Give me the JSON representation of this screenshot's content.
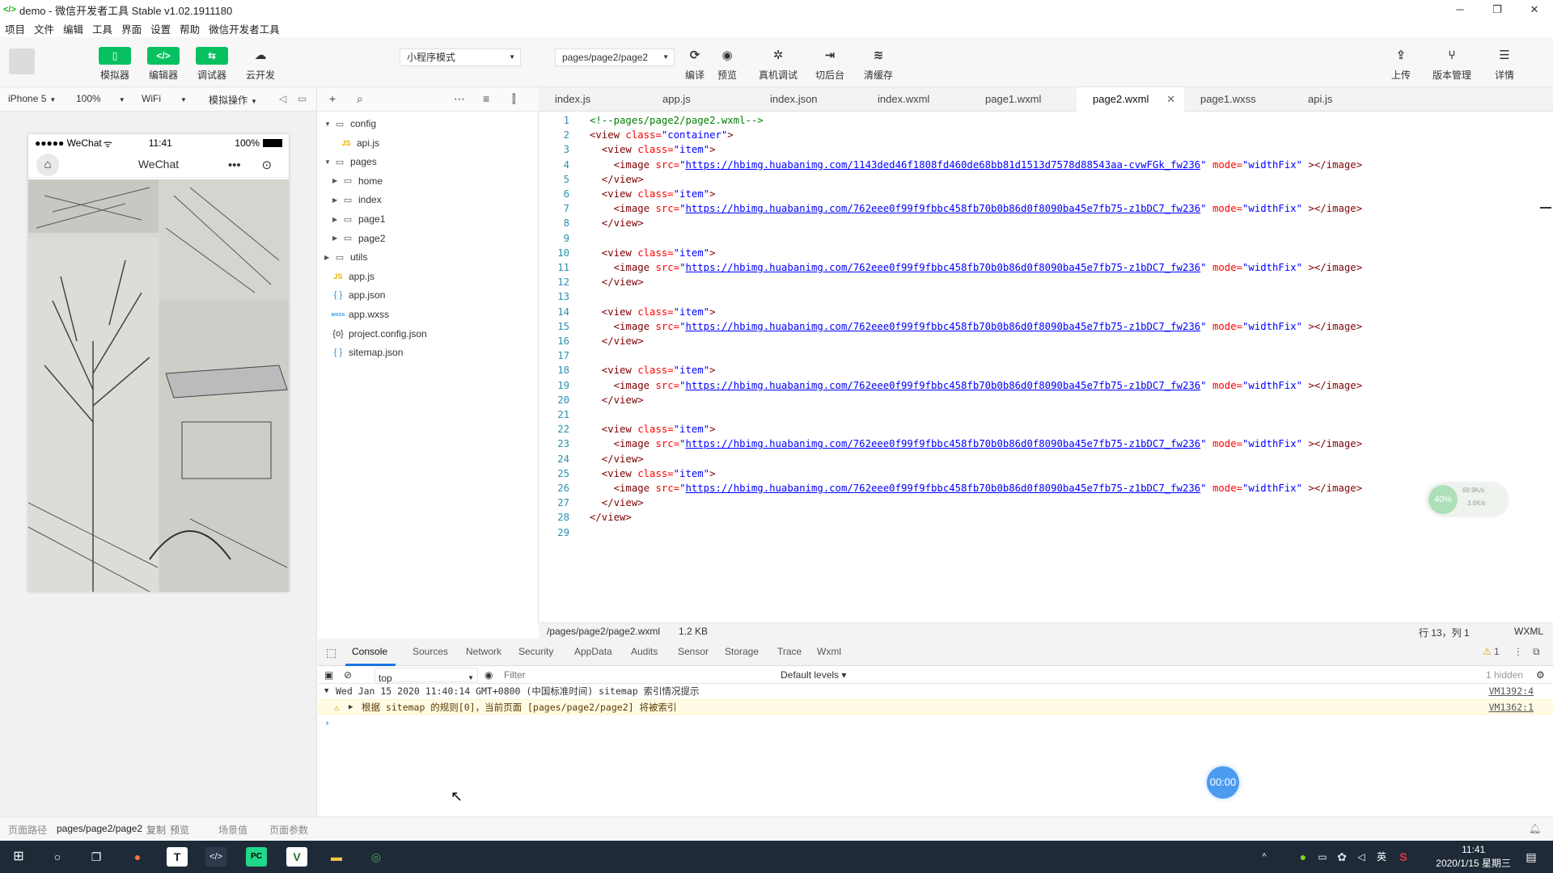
{
  "window": {
    "title": "demo - 微信开发者工具 Stable v1.02.1911180",
    "controls": [
      "─",
      "❐",
      "✕"
    ]
  },
  "menu": [
    "项目",
    "文件",
    "编辑",
    "工具",
    "界面",
    "设置",
    "帮助",
    "微信开发者工具"
  ],
  "toolbar": {
    "simulator": "模拟器",
    "editor": "编辑器",
    "debugger": "调试器",
    "cloud": "云开发",
    "mode_select": "小程序模式",
    "page_select": "pages/page2/page2",
    "compile": "编译",
    "preview": "预览",
    "remote_debug": "真机调试",
    "background": "切后台",
    "clear_cache": "清缓存",
    "upload": "上传",
    "version": "版本管理",
    "details": "详情"
  },
  "device_bar": {
    "device": "iPhone 5",
    "zoom": "100%",
    "network": "WiFi",
    "operations": "模拟操作"
  },
  "phone": {
    "signal": "●●●●● WeChat",
    "wifi": "ᯤ",
    "time": "11:41",
    "battery": "100%",
    "nav_title": "WeChat",
    "capsule_dots": "•••"
  },
  "explorer": [
    {
      "label": "config",
      "type": "folder",
      "depth": 0,
      "expanded": true
    },
    {
      "label": "api.js",
      "type": "js",
      "depth": 1
    },
    {
      "label": "pages",
      "type": "folder",
      "depth": 0,
      "expanded": true
    },
    {
      "label": "home",
      "type": "folder",
      "depth": 1,
      "expanded": false
    },
    {
      "label": "index",
      "type": "folder",
      "depth": 1,
      "expanded": false
    },
    {
      "label": "page1",
      "type": "folder",
      "depth": 1,
      "expanded": false
    },
    {
      "label": "page2",
      "type": "folder",
      "depth": 1,
      "expanded": false
    },
    {
      "label": "utils",
      "type": "folder",
      "depth": 0,
      "expanded": false
    },
    {
      "label": "app.js",
      "type": "js",
      "depth": 0
    },
    {
      "label": "app.json",
      "type": "json",
      "depth": 0
    },
    {
      "label": "app.wxss",
      "type": "wxss",
      "depth": 0
    },
    {
      "label": "project.config.json",
      "type": "config",
      "depth": 0
    },
    {
      "label": "sitemap.json",
      "type": "json",
      "depth": 0
    }
  ],
  "tabs": [
    "index.js",
    "app.js",
    "index.json",
    "index.wxml",
    "page1.wxml",
    "page2.wxml",
    "page1.wxss",
    "api.js"
  ],
  "active_tab": "page2.wxml",
  "code_lines": [
    [
      {
        "t": "<!--pages/page2/page2.wxml-->",
        "c": "comment"
      }
    ],
    [
      {
        "t": "<view ",
        "c": "tag"
      },
      {
        "t": "class=",
        "c": "attr"
      },
      {
        "t": "\"container\"",
        "c": "str"
      },
      {
        "t": ">",
        "c": "tag"
      }
    ],
    [
      {
        "t": "  <view ",
        "c": "tag"
      },
      {
        "t": "class=",
        "c": "attr"
      },
      {
        "t": "\"item\"",
        "c": "str"
      },
      {
        "t": ">",
        "c": "tag"
      }
    ],
    [
      {
        "t": "    <image ",
        "c": "tag"
      },
      {
        "t": "src=",
        "c": "attr"
      },
      {
        "t": "\"",
        "c": "str"
      },
      {
        "t": "https://hbimg.huabanimg.com/1143ded46f1808fd460de68bb81d1513d7578d88543aa-cvwFGk_fw236",
        "c": "url"
      },
      {
        "t": "\" ",
        "c": "str"
      },
      {
        "t": "mode=",
        "c": "attr"
      },
      {
        "t": "\"widthFix\"",
        "c": "str"
      },
      {
        "t": " ></image>",
        "c": "tag"
      }
    ],
    [
      {
        "t": "  </view>",
        "c": "tag"
      }
    ],
    [
      {
        "t": "  <view ",
        "c": "tag"
      },
      {
        "t": "class=",
        "c": "attr"
      },
      {
        "t": "\"item\"",
        "c": "str"
      },
      {
        "t": ">",
        "c": "tag"
      }
    ],
    [
      {
        "t": "    <image ",
        "c": "tag"
      },
      {
        "t": "src=",
        "c": "attr"
      },
      {
        "t": "\"",
        "c": "str"
      },
      {
        "t": "https://hbimg.huabanimg.com/762eee0f99f9fbbc458fb70b0b86d0f8090ba45e7fb75-z1bDC7_fw236",
        "c": "url"
      },
      {
        "t": "\" ",
        "c": "str"
      },
      {
        "t": "mode=",
        "c": "attr"
      },
      {
        "t": "\"widthFix\"",
        "c": "str"
      },
      {
        "t": " ></image>",
        "c": "tag"
      }
    ],
    [
      {
        "t": "  </view>",
        "c": "tag"
      }
    ],
    [],
    [
      {
        "t": "  <view ",
        "c": "tag"
      },
      {
        "t": "class=",
        "c": "attr"
      },
      {
        "t": "\"item\"",
        "c": "str"
      },
      {
        "t": ">",
        "c": "tag"
      }
    ],
    [
      {
        "t": "    <image ",
        "c": "tag"
      },
      {
        "t": "src=",
        "c": "attr"
      },
      {
        "t": "\"",
        "c": "str"
      },
      {
        "t": "https://hbimg.huabanimg.com/762eee0f99f9fbbc458fb70b0b86d0f8090ba45e7fb75-z1bDC7_fw236",
        "c": "url"
      },
      {
        "t": "\" ",
        "c": "str"
      },
      {
        "t": "mode=",
        "c": "attr"
      },
      {
        "t": "\"widthFix\"",
        "c": "str"
      },
      {
        "t": " ></image>",
        "c": "tag"
      }
    ],
    [
      {
        "t": "  </view>",
        "c": "tag"
      }
    ],
    [],
    [
      {
        "t": "  <view ",
        "c": "tag"
      },
      {
        "t": "class=",
        "c": "attr"
      },
      {
        "t": "\"item\"",
        "c": "str"
      },
      {
        "t": ">",
        "c": "tag"
      }
    ],
    [
      {
        "t": "    <image ",
        "c": "tag"
      },
      {
        "t": "src=",
        "c": "attr"
      },
      {
        "t": "\"",
        "c": "str"
      },
      {
        "t": "https://hbimg.huabanimg.com/762eee0f99f9fbbc458fb70b0b86d0f8090ba45e7fb75-z1bDC7_fw236",
        "c": "url"
      },
      {
        "t": "\" ",
        "c": "str"
      },
      {
        "t": "mode=",
        "c": "attr"
      },
      {
        "t": "\"widthFix\"",
        "c": "str"
      },
      {
        "t": " ></image>",
        "c": "tag"
      }
    ],
    [
      {
        "t": "  </view>",
        "c": "tag"
      }
    ],
    [],
    [
      {
        "t": "  <view ",
        "c": "tag"
      },
      {
        "t": "class=",
        "c": "attr"
      },
      {
        "t": "\"item\"",
        "c": "str"
      },
      {
        "t": ">",
        "c": "tag"
      }
    ],
    [
      {
        "t": "    <image ",
        "c": "tag"
      },
      {
        "t": "src=",
        "c": "attr"
      },
      {
        "t": "\"",
        "c": "str"
      },
      {
        "t": "https://hbimg.huabanimg.com/762eee0f99f9fbbc458fb70b0b86d0f8090ba45e7fb75-z1bDC7_fw236",
        "c": "url"
      },
      {
        "t": "\" ",
        "c": "str"
      },
      {
        "t": "mode=",
        "c": "attr"
      },
      {
        "t": "\"widthFix\"",
        "c": "str"
      },
      {
        "t": " ></image>",
        "c": "tag"
      }
    ],
    [
      {
        "t": "  </view>",
        "c": "tag"
      }
    ],
    [],
    [
      {
        "t": "  <view ",
        "c": "tag"
      },
      {
        "t": "class=",
        "c": "attr"
      },
      {
        "t": "\"item\"",
        "c": "str"
      },
      {
        "t": ">",
        "c": "tag"
      }
    ],
    [
      {
        "t": "    <image ",
        "c": "tag"
      },
      {
        "t": "src=",
        "c": "attr"
      },
      {
        "t": "\"",
        "c": "str"
      },
      {
        "t": "https://hbimg.huabanimg.com/762eee0f99f9fbbc458fb70b0b86d0f8090ba45e7fb75-z1bDC7_fw236",
        "c": "url"
      },
      {
        "t": "\" ",
        "c": "str"
      },
      {
        "t": "mode=",
        "c": "attr"
      },
      {
        "t": "\"widthFix\"",
        "c": "str"
      },
      {
        "t": " ></image>",
        "c": "tag"
      }
    ],
    [
      {
        "t": "  </view>",
        "c": "tag"
      }
    ],
    [
      {
        "t": "  <view ",
        "c": "tag"
      },
      {
        "t": "class=",
        "c": "attr"
      },
      {
        "t": "\"item\"",
        "c": "str"
      },
      {
        "t": ">",
        "c": "tag"
      }
    ],
    [
      {
        "t": "    <image ",
        "c": "tag"
      },
      {
        "t": "src=",
        "c": "attr"
      },
      {
        "t": "\"",
        "c": "str"
      },
      {
        "t": "https://hbimg.huabanimg.com/762eee0f99f9fbbc458fb70b0b86d0f8090ba45e7fb75-z1bDC7_fw236",
        "c": "url"
      },
      {
        "t": "\" ",
        "c": "str"
      },
      {
        "t": "mode=",
        "c": "attr"
      },
      {
        "t": "\"widthFix\"",
        "c": "str"
      },
      {
        "t": " ></image>",
        "c": "tag"
      }
    ],
    [
      {
        "t": "  </view>",
        "c": "tag"
      }
    ],
    [
      {
        "t": "</view>",
        "c": "tag"
      }
    ],
    []
  ],
  "editor_status": {
    "path": "/pages/page2/page2.wxml",
    "size": "1.2 KB",
    "cursor": "行 13，列 1",
    "lang": "WXML"
  },
  "devtools": {
    "tabs": [
      "Console",
      "Sources",
      "Network",
      "Security",
      "AppData",
      "Audits",
      "Sensor",
      "Storage",
      "Trace",
      "Wxml"
    ],
    "active": "Console",
    "warn_count": "1",
    "context": "top",
    "filter_placeholder": "Filter",
    "levels": "Default levels ▾",
    "hidden": "1 hidden",
    "log_header": "Wed Jan 15 2020 11:40:14 GMT+0800 (中国标准时间) sitemap 索引情况提示",
    "log_header_src": "VM1392:4",
    "warn_text": "根据 sitemap 的规则[0]，当前页面 [pages/page2/page2] 将被索引",
    "warn_src": "VM1362:1",
    "prompt": "›"
  },
  "timer_badge": "00:00",
  "net_widget": {
    "percent": "40%",
    "up": "69.9K/s",
    "down": "3.6K/s"
  },
  "page_path_bar": {
    "label": "页面路径",
    "path": "pages/page2/page2",
    "copy": "复制",
    "preview": "预览",
    "scene": "场景值",
    "params": "页面参数"
  },
  "taskbar": {
    "time": "11:41",
    "date": "2020/1/15 星期三",
    "ime": "英"
  },
  "colors": {
    "accent_green": "#07c160",
    "link_blue": "#1a73e8",
    "taskbar": "#1f2a38"
  }
}
